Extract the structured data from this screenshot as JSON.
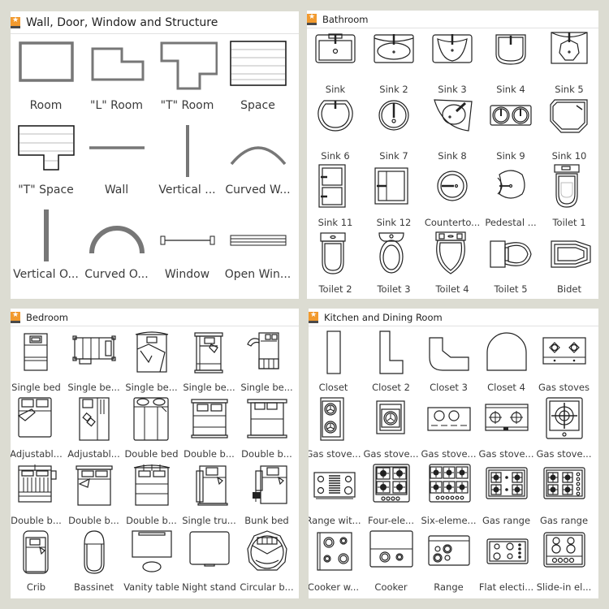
{
  "panels": {
    "wall": {
      "title": "Wall, Door, Window and Structure",
      "items": [
        {
          "label": "Room",
          "icon": "room-icon"
        },
        {
          "label": "\"L\" Room",
          "icon": "l-room-icon"
        },
        {
          "label": "\"T\" Room",
          "icon": "t-room-icon"
        },
        {
          "label": "Space",
          "icon": "space-icon"
        },
        {
          "label": "\"T\" Space",
          "icon": "t-space-icon"
        },
        {
          "label": "Wall",
          "icon": "wall-icon"
        },
        {
          "label": "Vertical ...",
          "icon": "vertical-wall-icon"
        },
        {
          "label": "Curved W...",
          "icon": "curved-wall-icon"
        },
        {
          "label": "Vertical O...",
          "icon": "vertical-opening-icon"
        },
        {
          "label": "Curved O...",
          "icon": "curved-opening-icon"
        },
        {
          "label": "Window",
          "icon": "window-icon"
        },
        {
          "label": "Open Win...",
          "icon": "open-window-icon"
        }
      ]
    },
    "bathroom": {
      "title": "Bathroom",
      "items": [
        {
          "label": "Sink",
          "icon": "sink-icon"
        },
        {
          "label": "Sink 2",
          "icon": "sink-2-icon"
        },
        {
          "label": "Sink 3",
          "icon": "sink-3-icon"
        },
        {
          "label": "Sink 4",
          "icon": "sink-4-icon"
        },
        {
          "label": "Sink 5",
          "icon": "sink-5-icon"
        },
        {
          "label": "Sink 6",
          "icon": "sink-6-icon"
        },
        {
          "label": "Sink 7",
          "icon": "sink-7-icon"
        },
        {
          "label": "Sink 8",
          "icon": "sink-8-icon"
        },
        {
          "label": "Sink 9",
          "icon": "sink-9-icon"
        },
        {
          "label": "Sink 10",
          "icon": "sink-10-icon"
        },
        {
          "label": "Sink 11",
          "icon": "sink-11-icon"
        },
        {
          "label": "Sink 12",
          "icon": "sink-12-icon"
        },
        {
          "label": "Counterto...",
          "icon": "countertop-sink-icon"
        },
        {
          "label": "Pedestal ...",
          "icon": "pedestal-sink-icon"
        },
        {
          "label": "Toilet 1",
          "icon": "toilet-1-icon"
        },
        {
          "label": "Toilet 2",
          "icon": "toilet-2-icon"
        },
        {
          "label": "Toilet 3",
          "icon": "toilet-3-icon"
        },
        {
          "label": "Toilet 4",
          "icon": "toilet-4-icon"
        },
        {
          "label": "Toilet 5",
          "icon": "toilet-5-icon"
        },
        {
          "label": "Bidet",
          "icon": "bidet-icon"
        }
      ]
    },
    "bedroom": {
      "title": "Bedroom",
      "items": [
        {
          "label": "Single bed",
          "icon": "single-bed-icon"
        },
        {
          "label": "Single be...",
          "icon": "single-bed-2-icon"
        },
        {
          "label": "Single be...",
          "icon": "single-bed-3-icon"
        },
        {
          "label": "Single be...",
          "icon": "single-bed-4-icon"
        },
        {
          "label": "Single be...",
          "icon": "single-bed-5-icon"
        },
        {
          "label": "Adjustabl...",
          "icon": "adjustable-bed-icon"
        },
        {
          "label": "Adjustabl...",
          "icon": "adjustable-bed-2-icon"
        },
        {
          "label": "Double bed",
          "icon": "double-bed-icon"
        },
        {
          "label": "Double b...",
          "icon": "double-bed-2-icon"
        },
        {
          "label": "Double b...",
          "icon": "double-bed-3-icon"
        },
        {
          "label": "Double b...",
          "icon": "double-bed-4-icon"
        },
        {
          "label": "Double b...",
          "icon": "double-bed-5-icon"
        },
        {
          "label": "Double b...",
          "icon": "double-bed-6-icon"
        },
        {
          "label": "Single tru...",
          "icon": "single-trundle-bed-icon"
        },
        {
          "label": "Bunk bed",
          "icon": "bunk-bed-icon"
        },
        {
          "label": "Crib",
          "icon": "crib-icon"
        },
        {
          "label": "Bassinet",
          "icon": "bassinet-icon"
        },
        {
          "label": "Vanity table",
          "icon": "vanity-table-icon"
        },
        {
          "label": "Night stand",
          "icon": "night-stand-icon"
        },
        {
          "label": "Circular b...",
          "icon": "circular-bed-icon"
        }
      ]
    },
    "kitchen": {
      "title": "Kitchen and Dining Room",
      "items": [
        {
          "label": "Closet",
          "icon": "closet-icon"
        },
        {
          "label": "Closet 2",
          "icon": "closet-2-icon"
        },
        {
          "label": "Closet 3",
          "icon": "closet-3-icon"
        },
        {
          "label": "Closet 4",
          "icon": "closet-4-icon"
        },
        {
          "label": "Gas stoves",
          "icon": "gas-stoves-icon"
        },
        {
          "label": "Gas stove...",
          "icon": "gas-stove-2-icon"
        },
        {
          "label": "Gas stove...",
          "icon": "gas-stove-3-icon"
        },
        {
          "label": "Gas stove...",
          "icon": "gas-stove-4-icon"
        },
        {
          "label": "Gas stove...",
          "icon": "gas-stove-5-icon"
        },
        {
          "label": "Gas stove...",
          "icon": "gas-stove-6-icon"
        },
        {
          "label": "Range wit...",
          "icon": "range-with-grill-icon"
        },
        {
          "label": "Four-ele...",
          "icon": "four-element-range-icon"
        },
        {
          "label": "Six-eleme...",
          "icon": "six-element-range-icon"
        },
        {
          "label": "Gas range",
          "icon": "gas-range-icon"
        },
        {
          "label": "Gas range",
          "icon": "gas-range-2-icon"
        },
        {
          "label": "Cooker w...",
          "icon": "cooker-with-oven-icon"
        },
        {
          "label": "Cooker",
          "icon": "cooker-icon"
        },
        {
          "label": "Range",
          "icon": "range-icon"
        },
        {
          "label": "Flat electi...",
          "icon": "flat-electric-range-icon"
        },
        {
          "label": "Slide-in el...",
          "icon": "slide-in-electric-range-icon"
        }
      ]
    }
  }
}
